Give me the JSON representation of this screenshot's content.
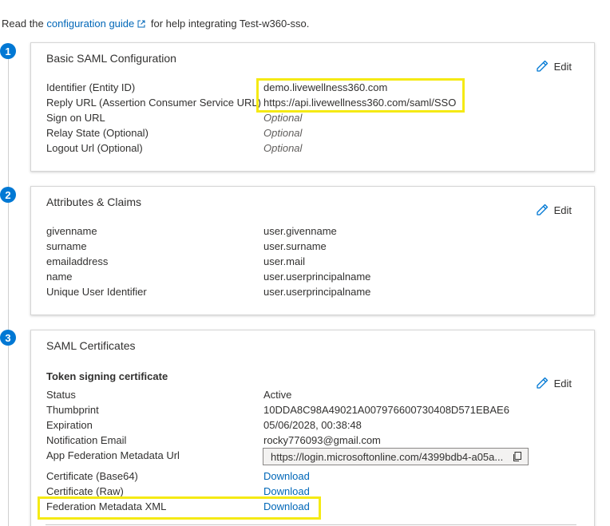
{
  "intro": {
    "prefix": "Read the",
    "link": "configuration guide",
    "suffix": "for help integrating Test-w360-sso."
  },
  "edit_label": "Edit",
  "sections": [
    {
      "step": "1",
      "title": "Basic SAML Configuration",
      "rows": [
        {
          "label": "Identifier (Entity ID)",
          "value": "demo.livewellness360.com"
        },
        {
          "label": "Reply URL (Assertion Consumer Service URL)",
          "value": "https://api.livewellness360.com/saml/SSO"
        },
        {
          "label": "Sign on URL",
          "value": "Optional"
        },
        {
          "label": "Relay State (Optional)",
          "value": "Optional"
        },
        {
          "label": "Logout Url (Optional)",
          "value": "Optional"
        }
      ]
    },
    {
      "step": "2",
      "title": "Attributes & Claims",
      "rows": [
        {
          "label": "givenname",
          "value": "user.givenname"
        },
        {
          "label": "surname",
          "value": "user.surname"
        },
        {
          "label": "emailaddress",
          "value": "user.mail"
        },
        {
          "label": "name",
          "value": "user.userprincipalname"
        },
        {
          "label": "Unique User Identifier",
          "value": "user.userprincipalname"
        }
      ]
    },
    {
      "step": "3",
      "title": "SAML Certificates",
      "subtitle": "Token signing certificate",
      "rows": [
        {
          "label": "Status",
          "value": "Active"
        },
        {
          "label": "Thumbprint",
          "value": "10DDA8C98A49021A007976600730408D571EBAE6"
        },
        {
          "label": "Expiration",
          "value": "05/06/2028, 00:38:48"
        },
        {
          "label": "Notification Email",
          "value": "rocky776093@gmail.com"
        },
        {
          "label": "App Federation Metadata Url",
          "value": "https://login.microsoftonline.com/4399bdb4-a05a..."
        },
        {
          "label": "Certificate (Base64)",
          "value": "Download"
        },
        {
          "label": "Certificate (Raw)",
          "value": "Download"
        },
        {
          "label": "Federation Metadata XML",
          "value": "Download"
        }
      ]
    }
  ],
  "colors": {
    "accent": "#0078d4",
    "link": "#0067b8",
    "highlight": "#f5ea14"
  }
}
